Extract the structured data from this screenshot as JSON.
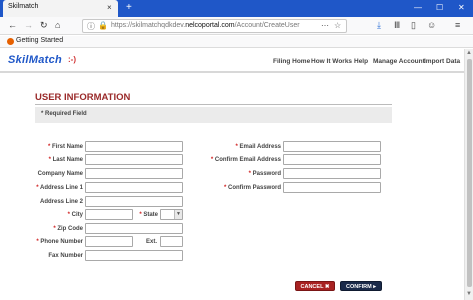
{
  "browser": {
    "tab_title": "Skilmatch",
    "tab_close": "×",
    "new_tab": "+",
    "win_min": "—",
    "win_max": "☐",
    "win_close": "✕",
    "url_prefix": "https://skilmatchqdkdev.",
    "url_host": "nelcoportal.com",
    "url_path": "/Account/CreateUser",
    "bookmark": "Getting Started"
  },
  "site": {
    "logo_text": "SkilMatch",
    "logo_mark": ":-)",
    "menu": [
      "Filing Home",
      "How It Works",
      "Help",
      "Manage Account",
      "Import Data"
    ]
  },
  "form": {
    "heading": "USER INFORMATION",
    "required_note": "* Required Field",
    "required_mark": "*",
    "left_fields": [
      {
        "label": "First Name",
        "required": true,
        "value": ""
      },
      {
        "label": "Last Name",
        "required": true,
        "value": ""
      },
      {
        "label": "Company Name",
        "required": false,
        "value": ""
      },
      {
        "label": "Address Line 1",
        "required": true,
        "value": ""
      },
      {
        "label": "Address Line 2",
        "required": false,
        "value": ""
      },
      {
        "label": "City",
        "required": true,
        "value": ""
      },
      {
        "label": "State",
        "required": true,
        "value": ""
      },
      {
        "label": "Zip Code",
        "required": true,
        "value": ""
      },
      {
        "label": "Phone Number",
        "required": true,
        "value": ""
      },
      {
        "label": "Ext.",
        "required": false,
        "value": ""
      },
      {
        "label": "Fax Number",
        "required": false,
        "value": ""
      }
    ],
    "right_fields": [
      {
        "label": "Email Address",
        "required": true,
        "value": ""
      },
      {
        "label": "Confirm Email Address",
        "required": true,
        "value": ""
      },
      {
        "label": "Password",
        "required": true,
        "value": ""
      },
      {
        "label": "Confirm Password",
        "required": true,
        "value": ""
      }
    ],
    "cancel_label": "CANCEL ✖",
    "confirm_label": "CONFIRM ▸"
  },
  "colors": {
    "tabstrip": "#1f57c8",
    "heading": "#9a2a2a",
    "required_star": "#d02020",
    "cancel_button": "#a82222",
    "confirm_button": "#1a2a4a"
  }
}
